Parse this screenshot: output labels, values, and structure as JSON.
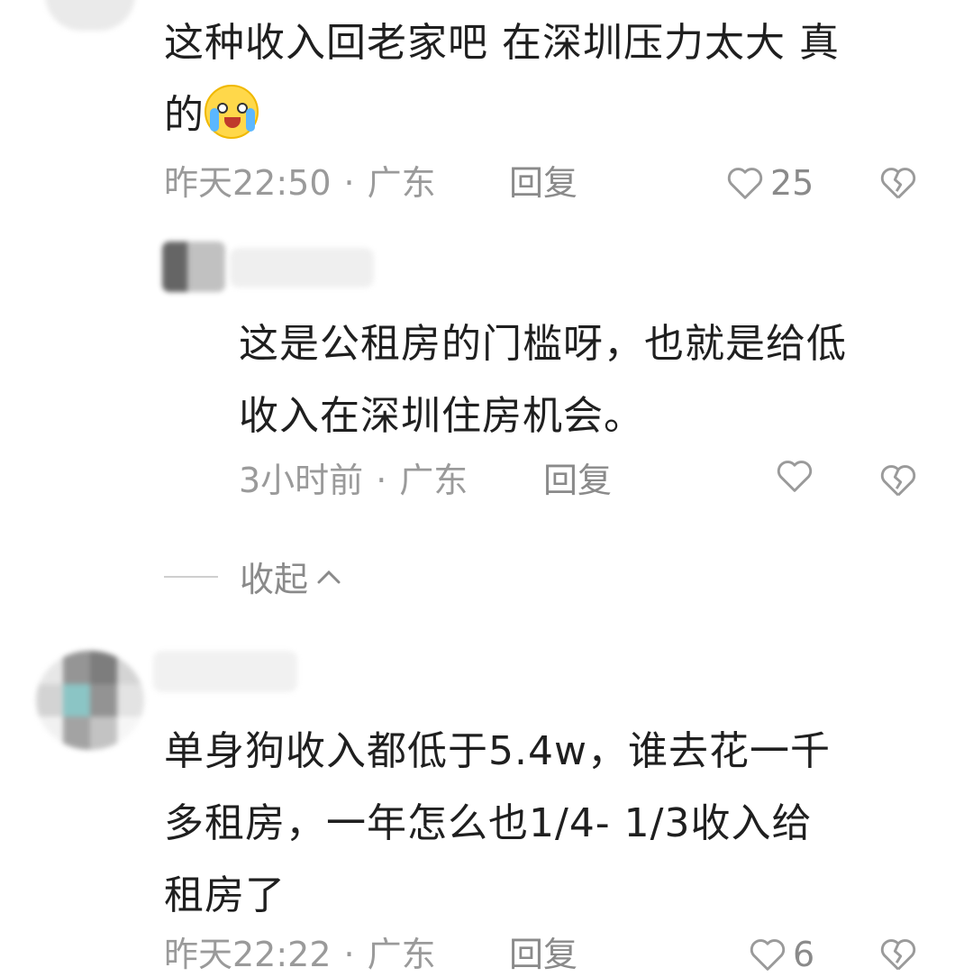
{
  "comments": [
    {
      "line1": "这种收入回老家吧 在深圳压力太大 真",
      "line2": "的",
      "emoji": "crying-laughing-face",
      "time": "昨天22:50",
      "location": "广东",
      "reply_label": "回复",
      "likes": "25"
    },
    {
      "line1": "这是公租房的门槛呀，也就是给低",
      "line2": "收入在深圳住房机会。",
      "time": "3小时前",
      "location": "广东",
      "reply_label": "回复",
      "likes": ""
    },
    {
      "line1": "单身狗收入都低于5.4w，谁去花一千",
      "line2": "多租房，一年怎么也1/4- 1/3收入给",
      "line3": "租房了",
      "time": "昨天22:22",
      "location": "广东",
      "reply_label": "回复",
      "likes": "6"
    }
  ],
  "collapse_label": "收起",
  "separator": "·",
  "icons": [
    "heart-outline-icon",
    "broken-heart-icon",
    "chevron-up-icon"
  ],
  "colors": {
    "text": "#1f1f1f",
    "meta": "#9a9a9a",
    "emoji": "#ffd84a"
  }
}
